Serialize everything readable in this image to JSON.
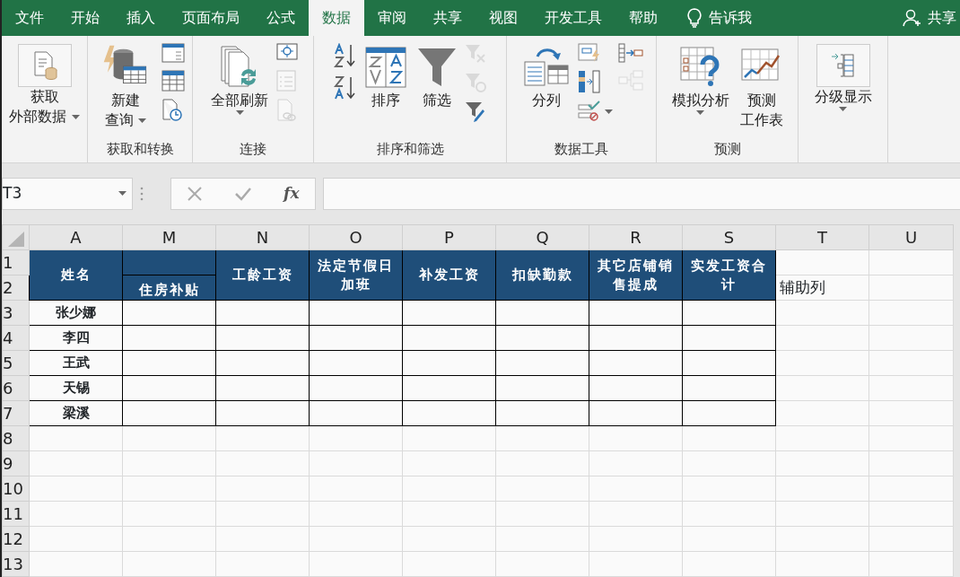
{
  "tabs": [
    {
      "label": "文件",
      "selected": false
    },
    {
      "label": "开始",
      "selected": false
    },
    {
      "label": "插入",
      "selected": false
    },
    {
      "label": "页面布局",
      "selected": false
    },
    {
      "label": "公式",
      "selected": false
    },
    {
      "label": "数据",
      "selected": true
    },
    {
      "label": "审阅",
      "selected": false
    },
    {
      "label": "共享",
      "selected": false
    },
    {
      "label": "视图",
      "selected": false
    },
    {
      "label": "开发工具",
      "selected": false
    },
    {
      "label": "帮助",
      "selected": false
    }
  ],
  "tell_me": {
    "label": "告诉我"
  },
  "share": {
    "label": "共享"
  },
  "ribbon_groups": [
    {
      "items": [
        {
          "kind": "framed",
          "lines": [
            "获取",
            "外部数据"
          ],
          "dropdown": true
        }
      ]
    },
    {
      "label": "获取和转换",
      "items": [
        {
          "kind": "large",
          "lines": [
            "新建",
            "查询"
          ],
          "dropdown": true
        },
        {
          "kind": "stack",
          "icons": [
            {
              "disabled": false
            },
            {
              "disabled": false
            },
            {
              "disabled": false
            }
          ]
        }
      ]
    },
    {
      "label": "连接",
      "items": [
        {
          "kind": "large",
          "lines": [
            "全部刷新"
          ],
          "dropdown": true
        },
        {
          "kind": "stack",
          "icons": [
            {
              "disabled": false
            },
            {
              "disabled": true
            },
            {
              "disabled": true
            }
          ]
        }
      ]
    },
    {
      "label": "排序和筛选",
      "items": [
        {
          "kind": "stack",
          "icons": [
            {
              "disabled": false
            },
            {
              "disabled": false
            }
          ]
        },
        {
          "kind": "large",
          "lines": [
            "排序"
          ],
          "dropdown": false
        },
        {
          "kind": "large",
          "lines": [
            "筛选"
          ],
          "dropdown": false
        },
        {
          "kind": "stack",
          "icons": [
            {
              "disabled": true
            },
            {
              "disabled": true
            },
            {
              "disabled": false
            }
          ]
        }
      ]
    },
    {
      "label": "数据工具",
      "items": [
        {
          "kind": "large",
          "lines": [
            "分列"
          ],
          "dropdown": false
        },
        {
          "kind": "stack",
          "icons": [
            {
              "disabled": false
            },
            {
              "disabled": false
            },
            {
              "disabled": false,
              "dropdown": true
            }
          ]
        },
        {
          "kind": "stack",
          "icons": [
            {
              "disabled": false
            },
            {
              "disabled": true
            }
          ]
        }
      ]
    },
    {
      "label": "预测",
      "items": [
        {
          "kind": "large",
          "lines": [
            "模拟分析"
          ],
          "dropdown": true
        },
        {
          "kind": "large",
          "lines": [
            "预测",
            "工作表"
          ],
          "dropdown": false
        }
      ]
    },
    {
      "items": [
        {
          "kind": "framed",
          "lines": [
            "分级显示"
          ],
          "dropdown": true
        }
      ]
    }
  ],
  "formula_bar": {
    "name_box": "T3",
    "function_label": "fx"
  },
  "sheet": {
    "columns": [
      "A",
      "M",
      "N",
      "O",
      "P",
      "Q",
      "R",
      "S",
      "T",
      "U"
    ],
    "row_numbers": [
      "1",
      "2",
      "3",
      "4",
      "5",
      "6",
      "7",
      "8",
      "9",
      "10",
      "11",
      "12",
      "13"
    ],
    "headers": [
      {
        "text": "姓名",
        "kind": "full"
      },
      {
        "text": "住房补贴",
        "kind": "lower"
      },
      {
        "text": "工龄工资",
        "kind": "full"
      },
      {
        "text": "法定节假日加班",
        "kind": "full"
      },
      {
        "text": "补发工资",
        "kind": "full"
      },
      {
        "text": "扣缺勤款",
        "kind": "full"
      },
      {
        "text": "其它店铺销售提成",
        "kind": "full"
      },
      {
        "text": "实发工资合计",
        "kind": "full"
      }
    ],
    "helper_label": "辅助列",
    "names": [
      "张少娜",
      "李四",
      "王武",
      "天锡",
      "梁溪"
    ]
  }
}
